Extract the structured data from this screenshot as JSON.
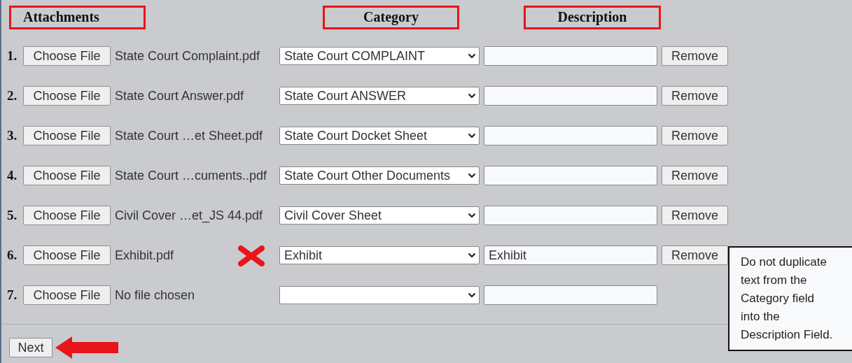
{
  "headers": [
    "Attachments",
    "Category",
    "Description"
  ],
  "rows": [
    {
      "number": "1.",
      "button": "Choose File",
      "file": "State Court Complaint.pdf",
      "category": "State Court COMPLAINT",
      "remove": "Remove",
      "flagged": false
    },
    {
      "number": "2.",
      "button": "Choose File",
      "file": "State Court Answer.pdf",
      "category": "State Court ANSWER",
      "remove": "Remove",
      "flagged": false
    },
    {
      "number": "3.",
      "button": "Choose File",
      "file": "State Court …et Sheet.pdf",
      "category": "State Court Docket Sheet",
      "remove": "Remove",
      "flagged": false
    },
    {
      "number": "4.",
      "button": "Choose File",
      "file": "State Court …cuments..pdf",
      "category": "State Court Other Documents",
      "remove": "Remove",
      "flagged": false
    },
    {
      "number": "5.",
      "button": "Choose File",
      "file": "Civil Cover …et_JS 44.pdf",
      "category": "Civil Cover Sheet",
      "remove": "Remove",
      "flagged": false
    },
    {
      "number": "6.",
      "button": "Choose File",
      "file": "Exhibit.pdf",
      "category": "Exhibit",
      "description": "Exhibit",
      "remove": "Remove",
      "flagged": true
    },
    {
      "number": "7.",
      "button": "Choose File",
      "file": "No file chosen",
      "flagged": false
    }
  ],
  "next_button": "Next",
  "tooltip": "Do not duplicate text from the Category field into the Description Field."
}
